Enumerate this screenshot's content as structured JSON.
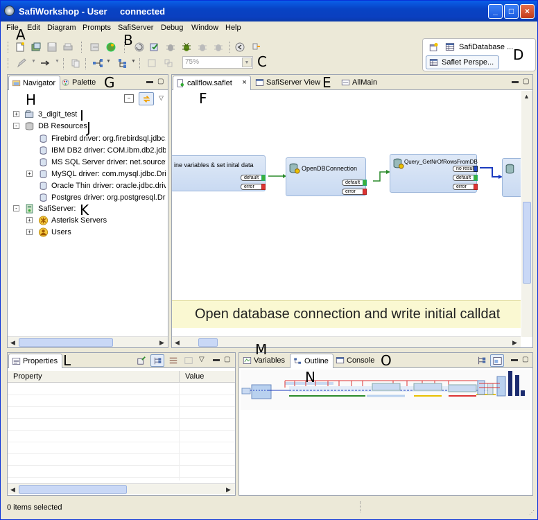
{
  "window": {
    "title": "SafiWorkshop - User",
    "status": "connected",
    "controls": {
      "minimize": "_",
      "maximize": "□",
      "close": "×"
    }
  },
  "menu": [
    "File",
    "Edit",
    "Diagram",
    "Prompts",
    "SafiServer",
    "Debug",
    "Window",
    "Help"
  ],
  "toolbar": {
    "zoom_value": "75%"
  },
  "perspectives": {
    "database": "SafiDatabase ...",
    "saflet": "Saflet Perspe..."
  },
  "annotation_letters": [
    "A",
    "B",
    "C",
    "D",
    "E",
    "F",
    "G",
    "H",
    "I",
    "J",
    "K",
    "L",
    "M",
    "N",
    "O"
  ],
  "navigator": {
    "tabs": [
      "Navigator",
      "Palette"
    ],
    "tree": [
      {
        "label": "3_digit_test",
        "level": 0,
        "expander": "+"
      },
      {
        "label": "DB Resources",
        "level": 0,
        "expander": "-"
      },
      {
        "label": "Firebird driver: org.firebirdsql.jdbc.",
        "level": 1,
        "expander": ""
      },
      {
        "label": "IBM DB2 driver: COM.ibm.db2.jdbc",
        "level": 1,
        "expander": ""
      },
      {
        "label": "MS SQL Server driver: net.sourcefo",
        "level": 1,
        "expander": ""
      },
      {
        "label": "MySQL driver: com.mysql.jdbc.Driv",
        "level": 1,
        "expander": "+"
      },
      {
        "label": "Oracle Thin driver: oracle.jdbc.driv",
        "level": 1,
        "expander": ""
      },
      {
        "label": "Postgres driver: org.postgresql.Dri",
        "level": 1,
        "expander": ""
      },
      {
        "label": "SafiServer:",
        "level": 0,
        "expander": "-"
      },
      {
        "label": "Asterisk Servers",
        "level": 1,
        "expander": "+"
      },
      {
        "label": "Users",
        "level": 1,
        "expander": "+"
      }
    ]
  },
  "editor": {
    "tabs": [
      "callflow.saflet",
      "SafiServer View",
      "AllMain"
    ],
    "close_glyph": "×",
    "nodes": {
      "init": "ine variables & set inital data",
      "open": "OpenDBConnection",
      "query": "Query_GetNrOfRowsFromDB"
    },
    "ports": {
      "default": "default",
      "error": "error",
      "no_result": "no result"
    },
    "banner": "Open database connection and write initial calldat"
  },
  "properties": {
    "tab": "Properties",
    "columns": [
      "Property",
      "Value"
    ]
  },
  "bottom_tabs": [
    "Variables",
    "Outline",
    "Console"
  ],
  "status": {
    "text": "0 items selected"
  }
}
